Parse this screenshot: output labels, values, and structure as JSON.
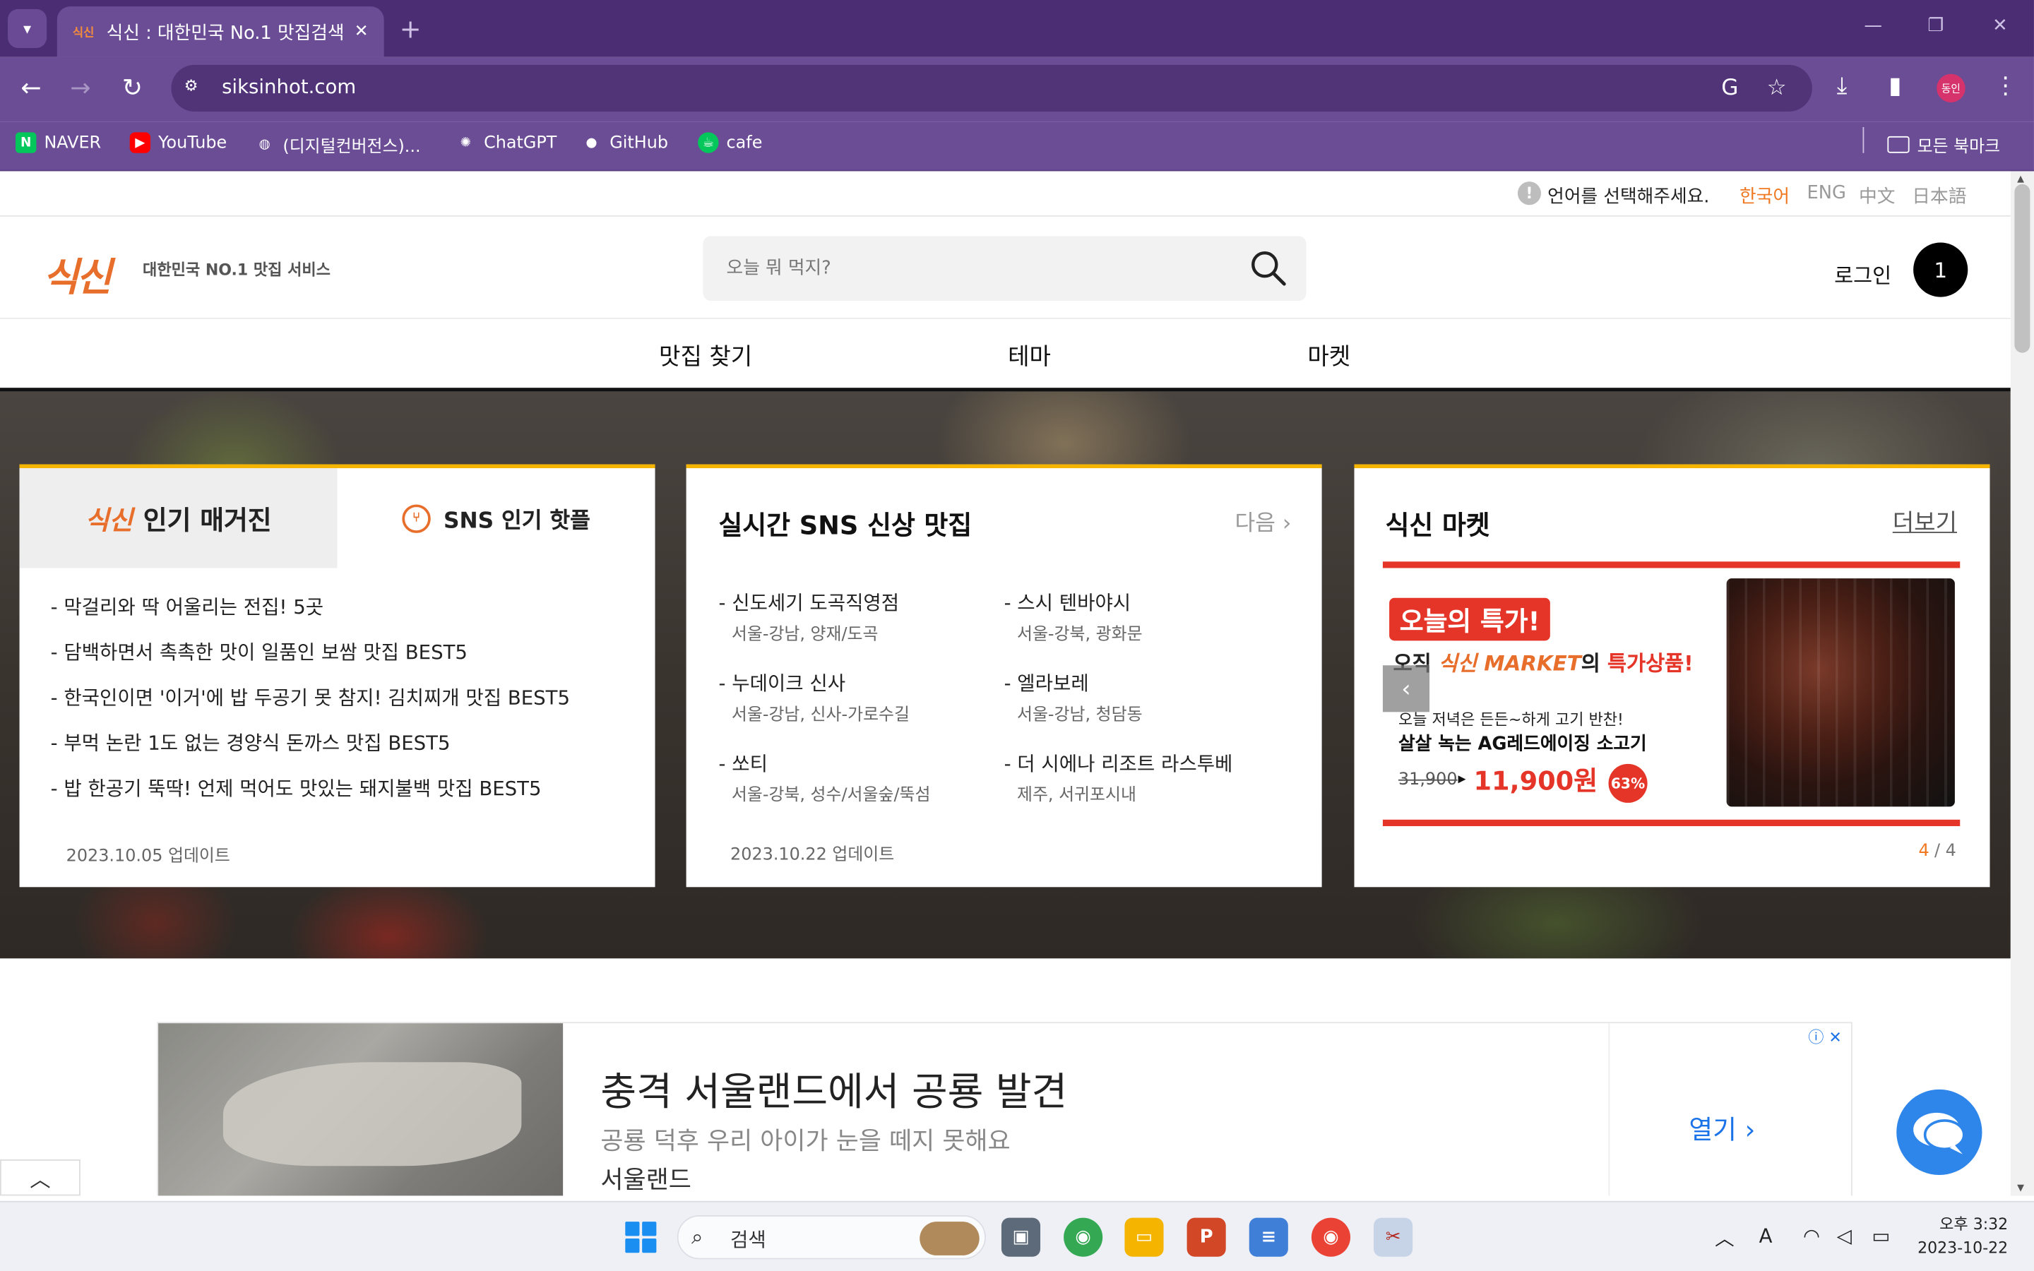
{
  "browser": {
    "tab_title": "식신 : 대한민국 No.1 맛집검색",
    "tab_favicon": "식신",
    "url": "siksinhot.com",
    "profile_label": "동인",
    "bookmarks": [
      {
        "label": "NAVER",
        "icon": "naver-icon",
        "color": "#03c75a"
      },
      {
        "label": "YouTube",
        "icon": "youtube-icon",
        "color": "#ff0000"
      },
      {
        "label": "(디지털컨버전스)...",
        "icon": "globe-icon",
        "color": "#ffffff"
      },
      {
        "label": "ChatGPT",
        "icon": "chatgpt-icon",
        "color": "#10a37f"
      },
      {
        "label": "GitHub",
        "icon": "github-icon",
        "color": "#ffffff"
      },
      {
        "label": "cafe",
        "icon": "cafe-icon",
        "color": "#03c75a"
      }
    ],
    "all_bookmarks_label": "모든 북마크"
  },
  "lang": {
    "prompt": "언어를 선택해주세요.",
    "options": [
      "한국어",
      "ENG",
      "中文",
      "日本語"
    ],
    "active": "한국어"
  },
  "header": {
    "logo": "식신",
    "logo_sub": "대한민국 NO.1 맛집 서비스",
    "search_placeholder": "오늘 뭐 먹지?",
    "login": "로그인",
    "badge": "1"
  },
  "gnb": [
    "맛집 찾기",
    "테마",
    "마켓"
  ],
  "magazine": {
    "tab1_brand": "식신",
    "tab1_label": "인기 매거진",
    "tab2_label": "SNS 인기 핫플",
    "items": [
      "- 막걸리와 딱 어울리는 전집! 5곳",
      "- 담백하면서 촉촉한 맛이 일품인 보쌈 맛집 BEST5",
      "- 한국인이면 '이거'에 밥 두공기 못 참지! 김치찌개 맛집 BEST5",
      "- 부먹 논란 1도 없는 경양식 돈까스 맛집 BEST5",
      "- 밥 한공기 뚝딱! 언제 먹어도 맛있는 돼지불백 맛집 BEST5"
    ],
    "updated": "2023.10.05 업데이트"
  },
  "sns": {
    "title": "실시간 SNS 신상 맛집",
    "next": "다음",
    "items": [
      {
        "name": "- 신도세기 도곡직영점",
        "loc": "서울-강남, 양재/도곡"
      },
      {
        "name": "- 스시 텐바야시",
        "loc": "서울-강북, 광화문"
      },
      {
        "name": "- 누데이크 신사",
        "loc": "서울-강남, 신사-가로수길"
      },
      {
        "name": "- 엘라보레",
        "loc": "서울-강남, 청담동"
      },
      {
        "name": "- 쏘티",
        "loc": "서울-강북, 성수/서울숲/뚝섬"
      },
      {
        "name": "- 더 시에나 리조트 라스투베",
        "loc": "제주, 서귀포시내"
      }
    ],
    "updated": "2023.10.22 업데이트"
  },
  "market": {
    "title": "식신 마켓",
    "more": "더보기",
    "tag": "오늘의 특가!",
    "line2_pre": "오직 ",
    "line2_brand": "식신 MARKET",
    "line2_mid": "의 ",
    "line2_hot": "특가상품!",
    "line3": "오늘 저녁은 든든~하게 고기 반찬!",
    "line4": "살살 녹는 AG레드에이징 소고기",
    "old_price": "31,900",
    "price": "11,900원",
    "discount": "63%",
    "page_current": "4",
    "page_total": "/ 4"
  },
  "ad": {
    "title": "충격 서울랜드에서 공룡 발견",
    "desc": "공룡 덕후 우리 아이가 눈을 떼지 못해요",
    "advertiser": "서울랜드",
    "open": "열기"
  },
  "taskbar": {
    "search_label": "검색",
    "time": "오후 3:32",
    "date": "2023-10-22"
  }
}
